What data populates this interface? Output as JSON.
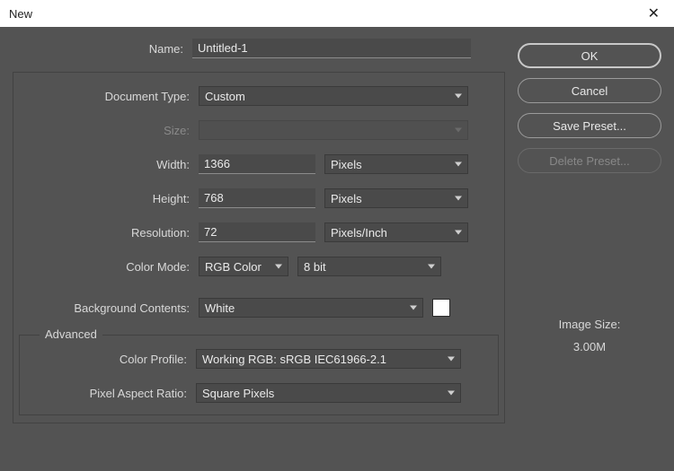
{
  "window": {
    "title": "New"
  },
  "buttons": {
    "ok": "OK",
    "cancel": "Cancel",
    "save_preset": "Save Preset...",
    "delete_preset": "Delete Preset..."
  },
  "image_size": {
    "label": "Image Size:",
    "value": "3.00M"
  },
  "form": {
    "name": {
      "label": "Name:",
      "value": "Untitled-1"
    },
    "doc_type": {
      "label": "Document Type:",
      "value": "Custom"
    },
    "size": {
      "label": "Size:",
      "value": ""
    },
    "width": {
      "label": "Width:",
      "value": "1366",
      "units": "Pixels"
    },
    "height": {
      "label": "Height:",
      "value": "768",
      "units": "Pixels"
    },
    "resolution": {
      "label": "Resolution:",
      "value": "72",
      "units": "Pixels/Inch"
    },
    "color_mode": {
      "label": "Color Mode:",
      "value": "RGB Color",
      "depth": "8 bit"
    },
    "background": {
      "label": "Background Contents:",
      "value": "White",
      "swatch": "#ffffff"
    },
    "advanced": {
      "legend": "Advanced",
      "color_profile": {
        "label": "Color Profile:",
        "value": "Working RGB:  sRGB IEC61966-2.1"
      },
      "pixel_aspect": {
        "label": "Pixel Aspect Ratio:",
        "value": "Square Pixels"
      }
    }
  }
}
